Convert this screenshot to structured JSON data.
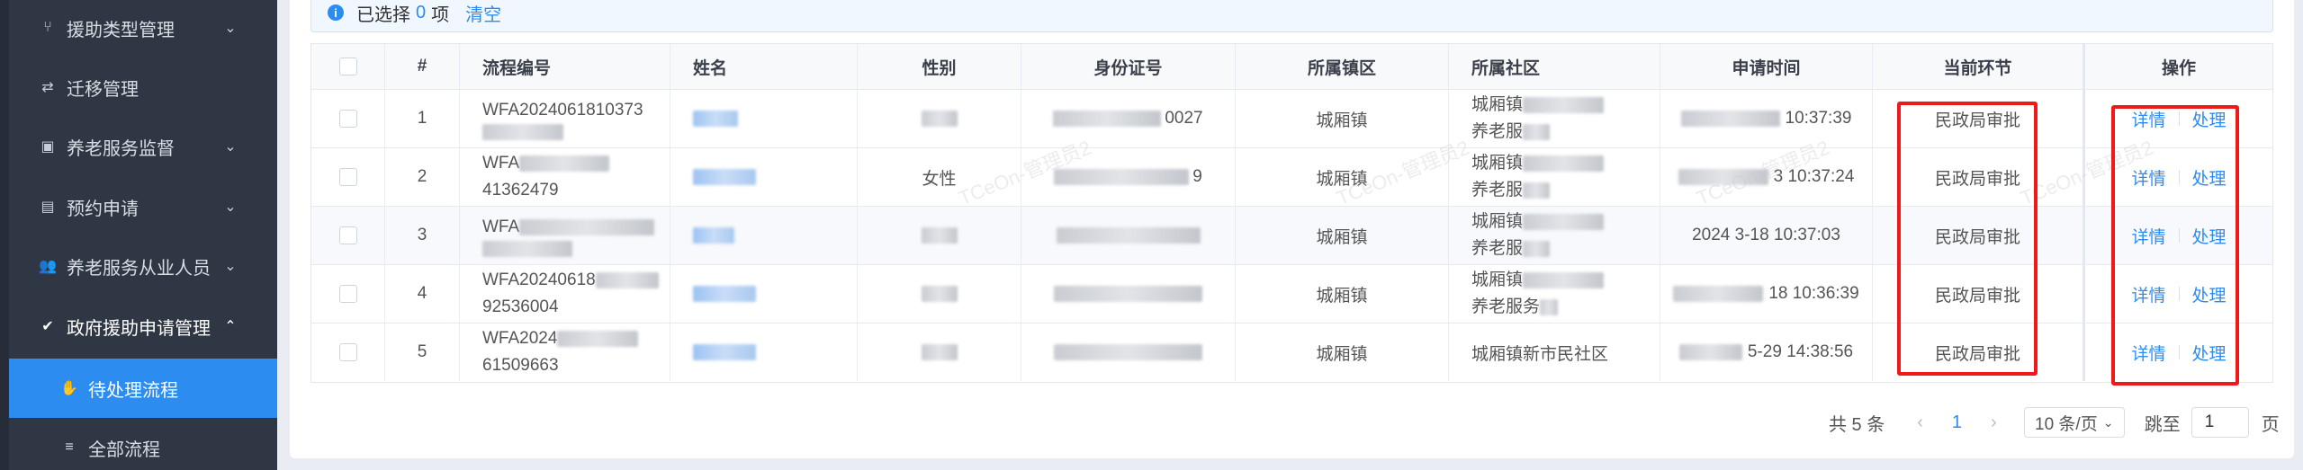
{
  "sidebar": {
    "items": [
      {
        "label": "援助类型管理",
        "icon": "fork-icon",
        "expandable": true
      },
      {
        "label": "迁移管理",
        "icon": "transfer-icon",
        "expandable": false
      },
      {
        "label": "养老服务监督",
        "icon": "clipboard-icon",
        "expandable": true
      },
      {
        "label": "预约申请",
        "icon": "calendar-icon",
        "expandable": true
      },
      {
        "label": "养老服务从业人员",
        "icon": "people-icon",
        "expandable": true
      },
      {
        "label": "政府援助申请管理",
        "icon": "check-circle-icon",
        "expandable": true,
        "open": true
      }
    ],
    "sub_items": [
      {
        "label": "待处理流程",
        "icon": "hand-icon",
        "active": true
      },
      {
        "label": "全部流程",
        "icon": "list-icon",
        "active": false
      }
    ]
  },
  "selection": {
    "prefix": "已选择",
    "count": "0",
    "suffix": "项",
    "clear": "清空"
  },
  "table": {
    "columns": [
      "#",
      "流程编号",
      "姓名",
      "性别",
      "身份证号",
      "所属镇区",
      "所属社区",
      "申请时间",
      "当前环节",
      "操作"
    ],
    "rows": [
      {
        "index": "1",
        "flow_line1": "WFA2024061810373",
        "flow_line2": "",
        "gender": "",
        "id_tail": "0027",
        "town": "城厢镇",
        "community_line1": "城厢镇",
        "community_line2": "养老服",
        "time": "10:37:39",
        "stage": "民政局审批"
      },
      {
        "index": "2",
        "flow_line1": "WFA",
        "flow_line2": "41362479",
        "gender": "女性",
        "id_tail": "9",
        "town": "城厢镇",
        "community_line1": "城厢镇",
        "community_line2": "养老服",
        "time": "3 10:37:24",
        "stage": "民政局审批"
      },
      {
        "index": "3",
        "flow_line1": "WFA",
        "flow_line2": "",
        "gender": "",
        "id_tail": "",
        "town": "城厢镇",
        "community_line1": "城厢镇",
        "community_line2": "养老服",
        "time": "2024 3-18 10:37:03",
        "stage": "民政局审批"
      },
      {
        "index": "4",
        "flow_line1": "WFA20240618",
        "flow_line2": "92536004",
        "gender": "",
        "id_tail": "",
        "town": "城厢镇",
        "community_line1": "城厢镇",
        "community_line2": "养老服务",
        "time": "18 10:36:39",
        "stage": "民政局审批"
      },
      {
        "index": "5",
        "flow_line1": "WFA2024",
        "flow_line2": "61509663",
        "gender": "",
        "id_tail": "",
        "town": "城厢镇",
        "community_line1": "城厢镇新市民社区",
        "community_line2": "",
        "time": "5-29 14:38:56",
        "stage": "民政局审批"
      }
    ],
    "action_detail": "详情",
    "action_handle": "处理"
  },
  "watermark": "TCeOn-管理员2",
  "pagination": {
    "total": "共 5 条",
    "prev": "‹",
    "page": "1",
    "next": "›",
    "page_size": "10 条/页",
    "jump_label": "跳至",
    "jump_value": "1",
    "page_suffix": "页"
  },
  "colors": {
    "accent": "#2d8cf0",
    "sidebar_bg": "#2f3745",
    "highlight_red": "#f01919"
  }
}
